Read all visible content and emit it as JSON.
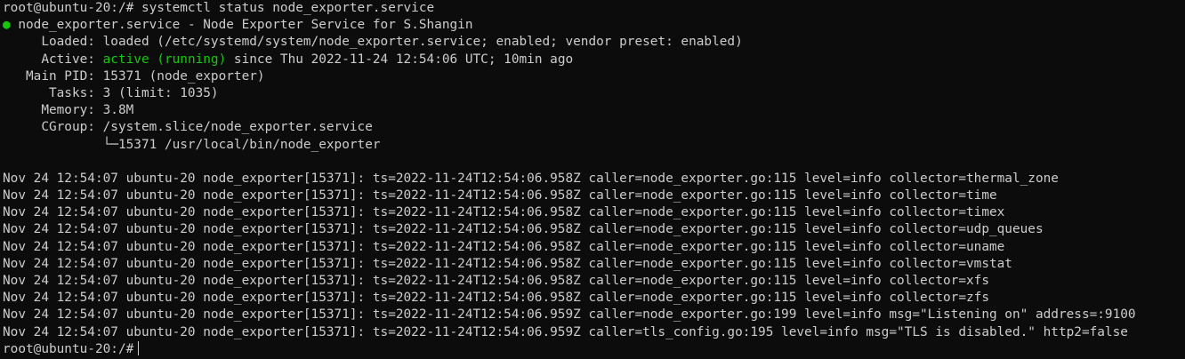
{
  "terminal": {
    "command_line": "root@ubuntu-20:/# systemctl status node_exporter.service",
    "status_dot": "●",
    "service_line": " node_exporter.service - Node Exporter Service for S.Shangin",
    "loaded_line": "     Loaded: loaded (/etc/systemd/system/node_exporter.service; enabled; vendor preset: enabled)",
    "active_label": "     Active: ",
    "active_state": "active (running)",
    "active_since": " since Thu 2022-11-24 12:54:06 UTC; 10min ago",
    "main_pid_line": "   Main PID: 15371 (node_exporter)",
    "tasks_line": "      Tasks: 3 (limit: 1035)",
    "memory_line": "     Memory: 3.8M",
    "cgroup_line": "     CGroup: /system.slice/node_exporter.service",
    "cgroup_child_line": "             └─15371 /usr/local/bin/node_exporter",
    "log_lines": [
      "Nov 24 12:54:07 ubuntu-20 node_exporter[15371]: ts=2022-11-24T12:54:06.958Z caller=node_exporter.go:115 level=info collector=thermal_zone",
      "Nov 24 12:54:07 ubuntu-20 node_exporter[15371]: ts=2022-11-24T12:54:06.958Z caller=node_exporter.go:115 level=info collector=time",
      "Nov 24 12:54:07 ubuntu-20 node_exporter[15371]: ts=2022-11-24T12:54:06.958Z caller=node_exporter.go:115 level=info collector=timex",
      "Nov 24 12:54:07 ubuntu-20 node_exporter[15371]: ts=2022-11-24T12:54:06.958Z caller=node_exporter.go:115 level=info collector=udp_queues",
      "Nov 24 12:54:07 ubuntu-20 node_exporter[15371]: ts=2022-11-24T12:54:06.958Z caller=node_exporter.go:115 level=info collector=uname",
      "Nov 24 12:54:07 ubuntu-20 node_exporter[15371]: ts=2022-11-24T12:54:06.958Z caller=node_exporter.go:115 level=info collector=vmstat",
      "Nov 24 12:54:07 ubuntu-20 node_exporter[15371]: ts=2022-11-24T12:54:06.958Z caller=node_exporter.go:115 level=info collector=xfs",
      "Nov 24 12:54:07 ubuntu-20 node_exporter[15371]: ts=2022-11-24T12:54:06.958Z caller=node_exporter.go:115 level=info collector=zfs",
      "Nov 24 12:54:07 ubuntu-20 node_exporter[15371]: ts=2022-11-24T12:54:06.959Z caller=node_exporter.go:199 level=info msg=\"Listening on\" address=:9100",
      "Nov 24 12:54:07 ubuntu-20 node_exporter[15371]: ts=2022-11-24T12:54:06.959Z caller=tls_config.go:195 level=info msg=\"TLS is disabled.\" http2=false"
    ],
    "prompt": "root@ubuntu-20:/#"
  },
  "colors": {
    "background": "#0c0c0c",
    "text": "#cccccc",
    "active_green": "#16c60c"
  }
}
